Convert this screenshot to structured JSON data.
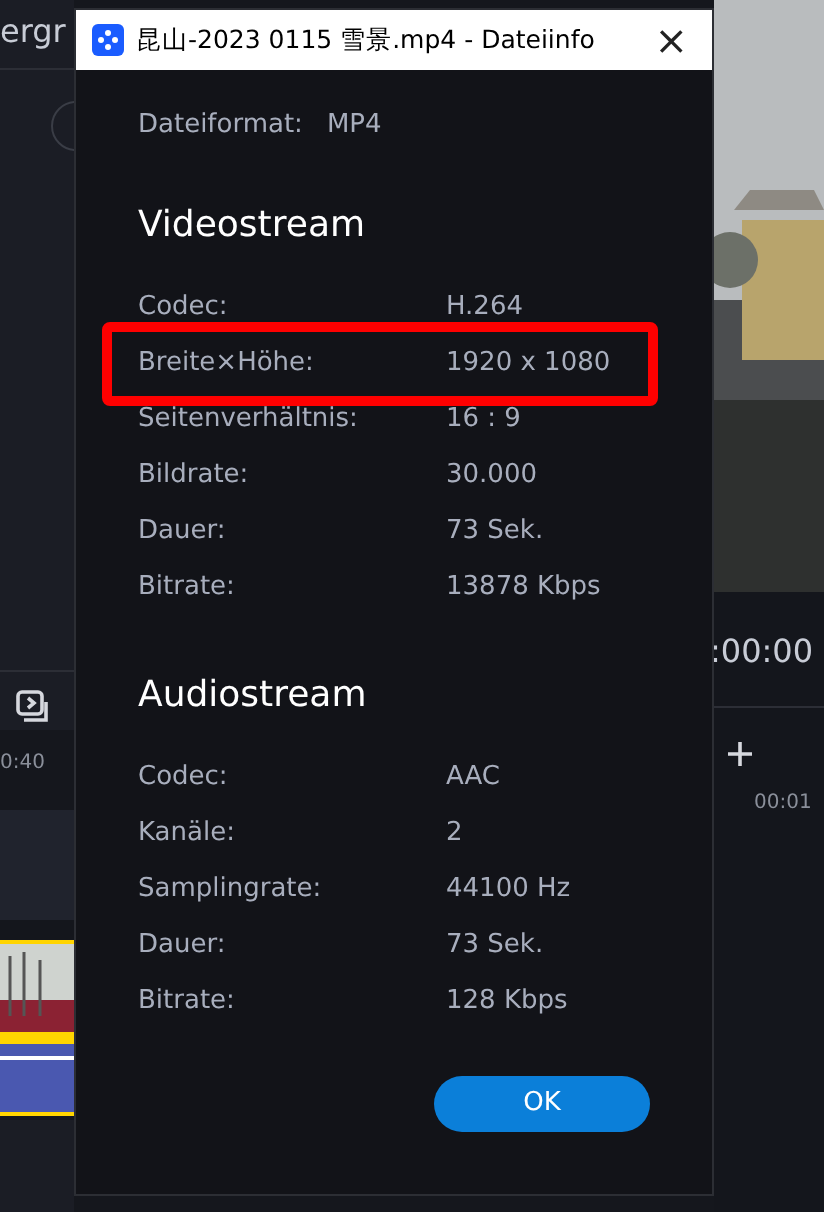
{
  "background_app": {
    "left_title": "ergr",
    "left_time": "0:40",
    "right_timer": ":00:00",
    "right_time": "00:01"
  },
  "window": {
    "title": "昆山-2023 0115 雪景.mp4 - Dateiinfo",
    "close": "×"
  },
  "file_format": {
    "label": "Dateiformat:",
    "value": "MP4"
  },
  "sections": [
    {
      "heading": "Videostream",
      "rows": [
        {
          "label": "Codec:",
          "value": "H.264",
          "highlighted": false
        },
        {
          "label": "Breite×Höhe:",
          "value": "1920 x 1080",
          "highlighted": true
        },
        {
          "label": "Seitenverhältnis:",
          "value": "16 : 9",
          "highlighted": false
        },
        {
          "label": "Bildrate:",
          "value": "30.000",
          "highlighted": false
        },
        {
          "label": "Dauer:",
          "value": "73 Sek.",
          "highlighted": false
        },
        {
          "label": "Bitrate:",
          "value": "13878 Kbps",
          "highlighted": false
        }
      ]
    },
    {
      "heading": "Audiostream",
      "rows": [
        {
          "label": "Codec:",
          "value": "AAC",
          "highlighted": false
        },
        {
          "label": "Kanäle:",
          "value": "2",
          "highlighted": false
        },
        {
          "label": "Samplingrate:",
          "value": "44100 Hz",
          "highlighted": false
        },
        {
          "label": "Dauer:",
          "value": "73 Sek.",
          "highlighted": false
        },
        {
          "label": "Bitrate:",
          "value": "128 Kbps",
          "highlighted": false
        }
      ]
    }
  ],
  "buttons": [
    "OK"
  ]
}
